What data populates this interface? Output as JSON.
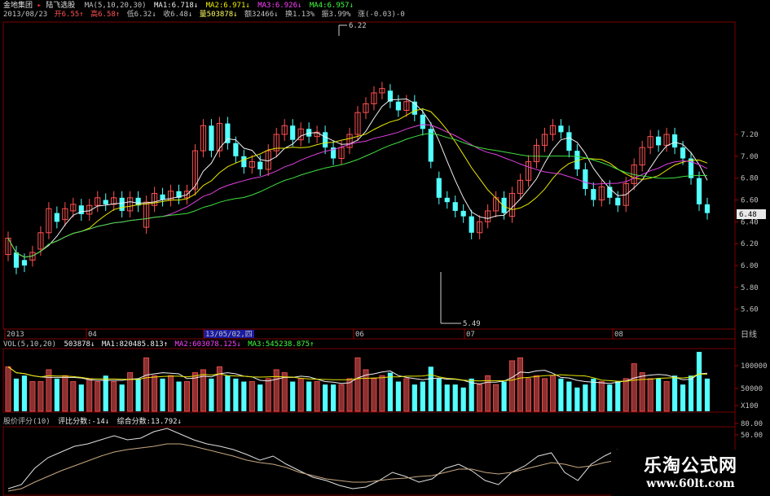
{
  "header": {
    "stock_name": "金地集团",
    "indicator_name": "陆飞选股",
    "ma_params": "MA(5,10,20,30)",
    "ma1": "MA1:6.718↓",
    "ma2": "MA2:6.971↓",
    "ma3": "MA3:6.926↓",
    "ma4": "MA4:6.957↓"
  },
  "quote_bar": {
    "date": "2013/08/23",
    "open": "开6.55↑",
    "high": "高6.58↑",
    "low": "低6.32↓",
    "close": "收6.48↓",
    "volume": "量503878↓",
    "amount": "额32466↓",
    "turnover": "换1.13%",
    "amplitude": "振3.99%",
    "change": "涨(-0.03)-0"
  },
  "price_chart": {
    "high_marker": "6.22",
    "low_marker": "5.49",
    "current_price": "6.48",
    "y_ticks": [
      "7.20",
      "7.00",
      "6.80",
      "6.60",
      "6.40",
      "6.20",
      "6.00",
      "5.80",
      "5.60"
    ]
  },
  "time_axis": {
    "labels": [
      "2013",
      "04",
      "13/05/02,四",
      "06",
      "07",
      "08"
    ],
    "period": "日线"
  },
  "vol_panel": {
    "title": "VOL(5,10,20)",
    "value": "503878↓",
    "ma1": "MA1:820485.813↑",
    "ma2": "MA2:603078.125↓",
    "ma3": "MA3:545238.875↑",
    "y_ticks": [
      "100000",
      "50000",
      "X100"
    ]
  },
  "score_panel": {
    "title": "股价评分(10)",
    "comparative": "评比分数:-14↓",
    "composite": "综合分数:13.792↓",
    "y_ticks": [
      "80.00",
      "50.00"
    ]
  },
  "watermark": {
    "name": "乐淘公式网",
    "url": "www.60lt.com"
  },
  "chart_data": {
    "type": "candlestick",
    "ylim": [
      5.49,
      7.28
    ],
    "candles": [
      {
        "o": 6.1,
        "c": 6.25
      },
      {
        "o": 6.12,
        "c": 5.98
      },
      {
        "o": 6.05,
        "c": 6.0
      },
      {
        "o": 6.05,
        "c": 6.12
      },
      {
        "o": 6.15,
        "c": 6.3
      },
      {
        "o": 6.3,
        "c": 6.52
      },
      {
        "o": 6.48,
        "c": 6.4
      },
      {
        "o": 6.42,
        "c": 6.52
      },
      {
        "o": 6.5,
        "c": 6.56
      },
      {
        "o": 6.55,
        "c": 6.47
      },
      {
        "o": 6.47,
        "c": 6.55
      },
      {
        "o": 6.55,
        "c": 6.62
      },
      {
        "o": 6.6,
        "c": 6.56
      },
      {
        "o": 6.56,
        "c": 6.62
      },
      {
        "o": 6.62,
        "c": 6.5
      },
      {
        "o": 6.5,
        "c": 6.62
      },
      {
        "o": 6.62,
        "c": 6.55
      },
      {
        "o": 6.35,
        "c": 6.58
      },
      {
        "o": 6.55,
        "c": 6.66
      },
      {
        "o": 6.65,
        "c": 6.6
      },
      {
        "o": 6.6,
        "c": 6.68
      },
      {
        "o": 6.68,
        "c": 6.62
      },
      {
        "o": 6.62,
        "c": 6.68
      },
      {
        "o": 6.7,
        "c": 7.05
      },
      {
        "o": 7.05,
        "c": 7.28
      },
      {
        "o": 7.28,
        "c": 7.05
      },
      {
        "o": 7.05,
        "c": 7.3
      },
      {
        "o": 7.3,
        "c": 7.12
      },
      {
        "o": 7.12,
        "c": 7.0
      },
      {
        "o": 7.0,
        "c": 6.9
      },
      {
        "o": 6.9,
        "c": 6.95
      },
      {
        "o": 6.95,
        "c": 6.88
      },
      {
        "o": 6.88,
        "c": 7.05
      },
      {
        "o": 7.05,
        "c": 7.2
      },
      {
        "o": 7.2,
        "c": 7.28
      },
      {
        "o": 7.28,
        "c": 7.15
      },
      {
        "o": 7.15,
        "c": 7.25
      },
      {
        "o": 7.25,
        "c": 7.18
      },
      {
        "o": 7.18,
        "c": 7.22
      },
      {
        "o": 7.22,
        "c": 7.08
      },
      {
        "o": 7.08,
        "c": 6.98
      },
      {
        "o": 6.98,
        "c": 7.08
      },
      {
        "o": 7.08,
        "c": 7.2
      },
      {
        "o": 7.2,
        "c": 7.4
      },
      {
        "o": 7.4,
        "c": 7.48
      },
      {
        "o": 7.48,
        "c": 7.58
      },
      {
        "o": 7.58,
        "c": 7.62
      },
      {
        "o": 7.6,
        "c": 7.5
      },
      {
        "o": 7.5,
        "c": 7.42
      },
      {
        "o": 7.42,
        "c": 7.5
      },
      {
        "o": 7.5,
        "c": 7.38
      },
      {
        "o": 7.38,
        "c": 7.25
      },
      {
        "o": 7.25,
        "c": 6.95
      },
      {
        "o": 6.8,
        "c": 6.62
      },
      {
        "o": 6.62,
        "c": 6.58
      },
      {
        "o": 6.58,
        "c": 6.5
      },
      {
        "o": 6.5,
        "c": 6.45
      },
      {
        "o": 6.45,
        "c": 6.3
      },
      {
        "o": 6.3,
        "c": 6.4
      },
      {
        "o": 6.4,
        "c": 6.5
      },
      {
        "o": 6.5,
        "c": 6.62
      },
      {
        "o": 6.62,
        "c": 6.48
      },
      {
        "o": 6.45,
        "c": 6.66
      },
      {
        "o": 6.66,
        "c": 6.78
      },
      {
        "o": 6.78,
        "c": 6.95
      },
      {
        "o": 6.95,
        "c": 7.1
      },
      {
        "o": 7.1,
        "c": 7.2
      },
      {
        "o": 7.2,
        "c": 7.28
      },
      {
        "o": 7.28,
        "c": 7.22
      },
      {
        "o": 7.22,
        "c": 7.05
      },
      {
        "o": 7.05,
        "c": 6.88
      },
      {
        "o": 6.88,
        "c": 6.7
      },
      {
        "o": 6.7,
        "c": 6.6
      },
      {
        "o": 6.6,
        "c": 6.72
      },
      {
        "o": 6.72,
        "c": 6.62
      },
      {
        "o": 6.62,
        "c": 6.55
      },
      {
        "o": 6.55,
        "c": 6.75
      },
      {
        "o": 6.75,
        "c": 6.92
      },
      {
        "o": 6.92,
        "c": 7.08
      },
      {
        "o": 7.08,
        "c": 7.18
      },
      {
        "o": 7.18,
        "c": 7.1
      },
      {
        "o": 7.1,
        "c": 7.2
      },
      {
        "o": 7.2,
        "c": 7.08
      },
      {
        "o": 7.08,
        "c": 6.98
      },
      {
        "o": 6.98,
        "c": 6.8
      },
      {
        "o": 6.8,
        "c": 6.56
      },
      {
        "o": 6.56,
        "c": 6.48
      }
    ],
    "volumes": [
      0.75,
      0.55,
      0.6,
      0.5,
      0.5,
      0.7,
      0.55,
      0.6,
      0.5,
      0.45,
      0.55,
      0.5,
      0.6,
      0.5,
      0.45,
      0.65,
      0.55,
      0.9,
      0.6,
      0.55,
      0.6,
      0.5,
      0.5,
      0.65,
      0.7,
      0.55,
      0.75,
      0.6,
      0.55,
      0.5,
      0.5,
      0.45,
      0.55,
      0.7,
      0.65,
      0.5,
      0.55,
      0.5,
      0.5,
      0.45,
      0.45,
      0.45,
      0.55,
      0.9,
      0.7,
      0.55,
      0.6,
      0.65,
      0.5,
      0.55,
      0.45,
      0.5,
      0.75,
      0.55,
      0.45,
      0.45,
      0.4,
      0.55,
      0.45,
      0.6,
      0.45,
      0.5,
      0.85,
      0.9,
      0.55,
      0.6,
      0.55,
      0.6,
      0.55,
      0.5,
      0.4,
      0.45,
      0.55,
      0.5,
      0.45,
      0.5,
      0.55,
      0.8,
      0.65,
      0.55,
      0.55,
      0.5,
      0.6,
      0.45,
      0.6,
      1.0,
      0.55
    ]
  }
}
